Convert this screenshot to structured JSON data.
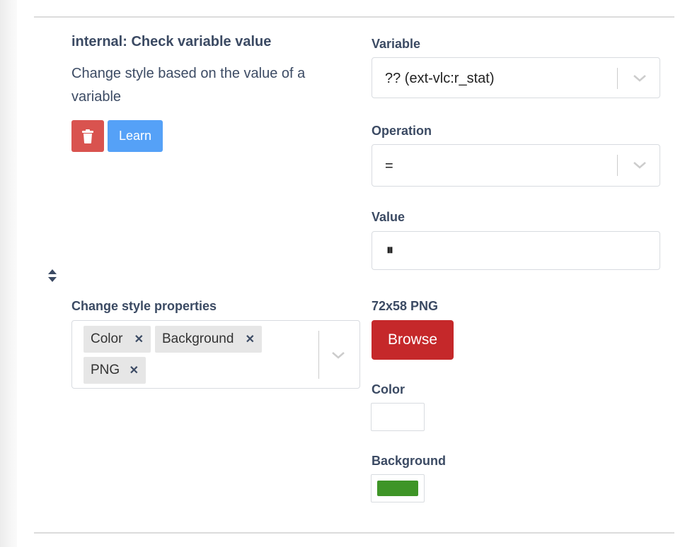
{
  "feedback": {
    "name": "internal: Check variable value",
    "description": "Change style based on the value of a variable",
    "learn_label": "Learn"
  },
  "options": {
    "variable_label": "Variable",
    "variable_value": "?? (ext-vlc:r_stat)",
    "operation_label": "Operation",
    "operation_value": "=",
    "value_label": "Value",
    "value_value": "⏸"
  },
  "style_properties": {
    "label": "Change style properties",
    "chips": [
      {
        "label": "Color"
      },
      {
        "label": "Background"
      },
      {
        "label": "PNG"
      }
    ],
    "remove_glyph": "✕"
  },
  "style_values": {
    "png_label": "72x58 PNG",
    "browse_label": "Browse",
    "color_label": "Color",
    "color_value": "#ffffff",
    "background_label": "Background",
    "background_value": "#3e9527"
  },
  "icons": [
    "trash-icon",
    "sort-handle-icon",
    "chevron-down-icon",
    "remove-chip-icon"
  ]
}
